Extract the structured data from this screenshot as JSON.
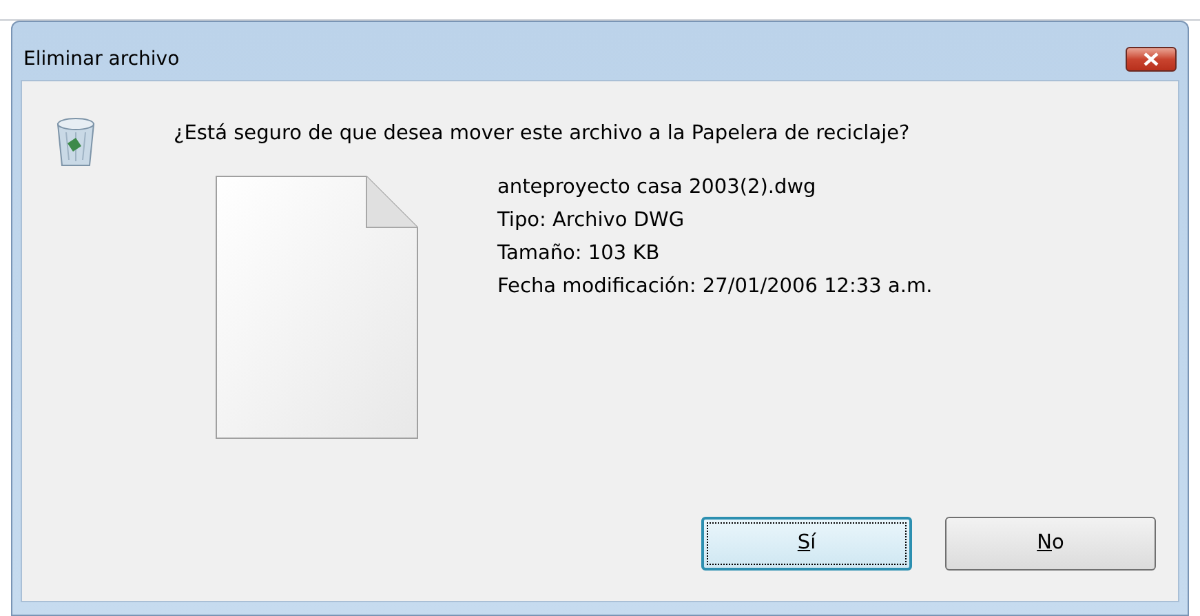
{
  "window": {
    "title": "Eliminar archivo"
  },
  "message": "¿Está seguro de que desea mover este archivo a la Papelera de reciclaje?",
  "file": {
    "name": "anteproyecto casa 2003(2).dwg",
    "details": [
      "Tipo: Archivo DWG",
      "Tamaño: 103 KB",
      "Fecha modificación: 27/01/2006 12:33 a.m."
    ]
  },
  "buttons": [
    {
      "label": "Sí",
      "first_letter_underlined": true,
      "focused": true
    },
    {
      "label": "No",
      "first_letter_underlined": true,
      "focused": false
    }
  ]
}
